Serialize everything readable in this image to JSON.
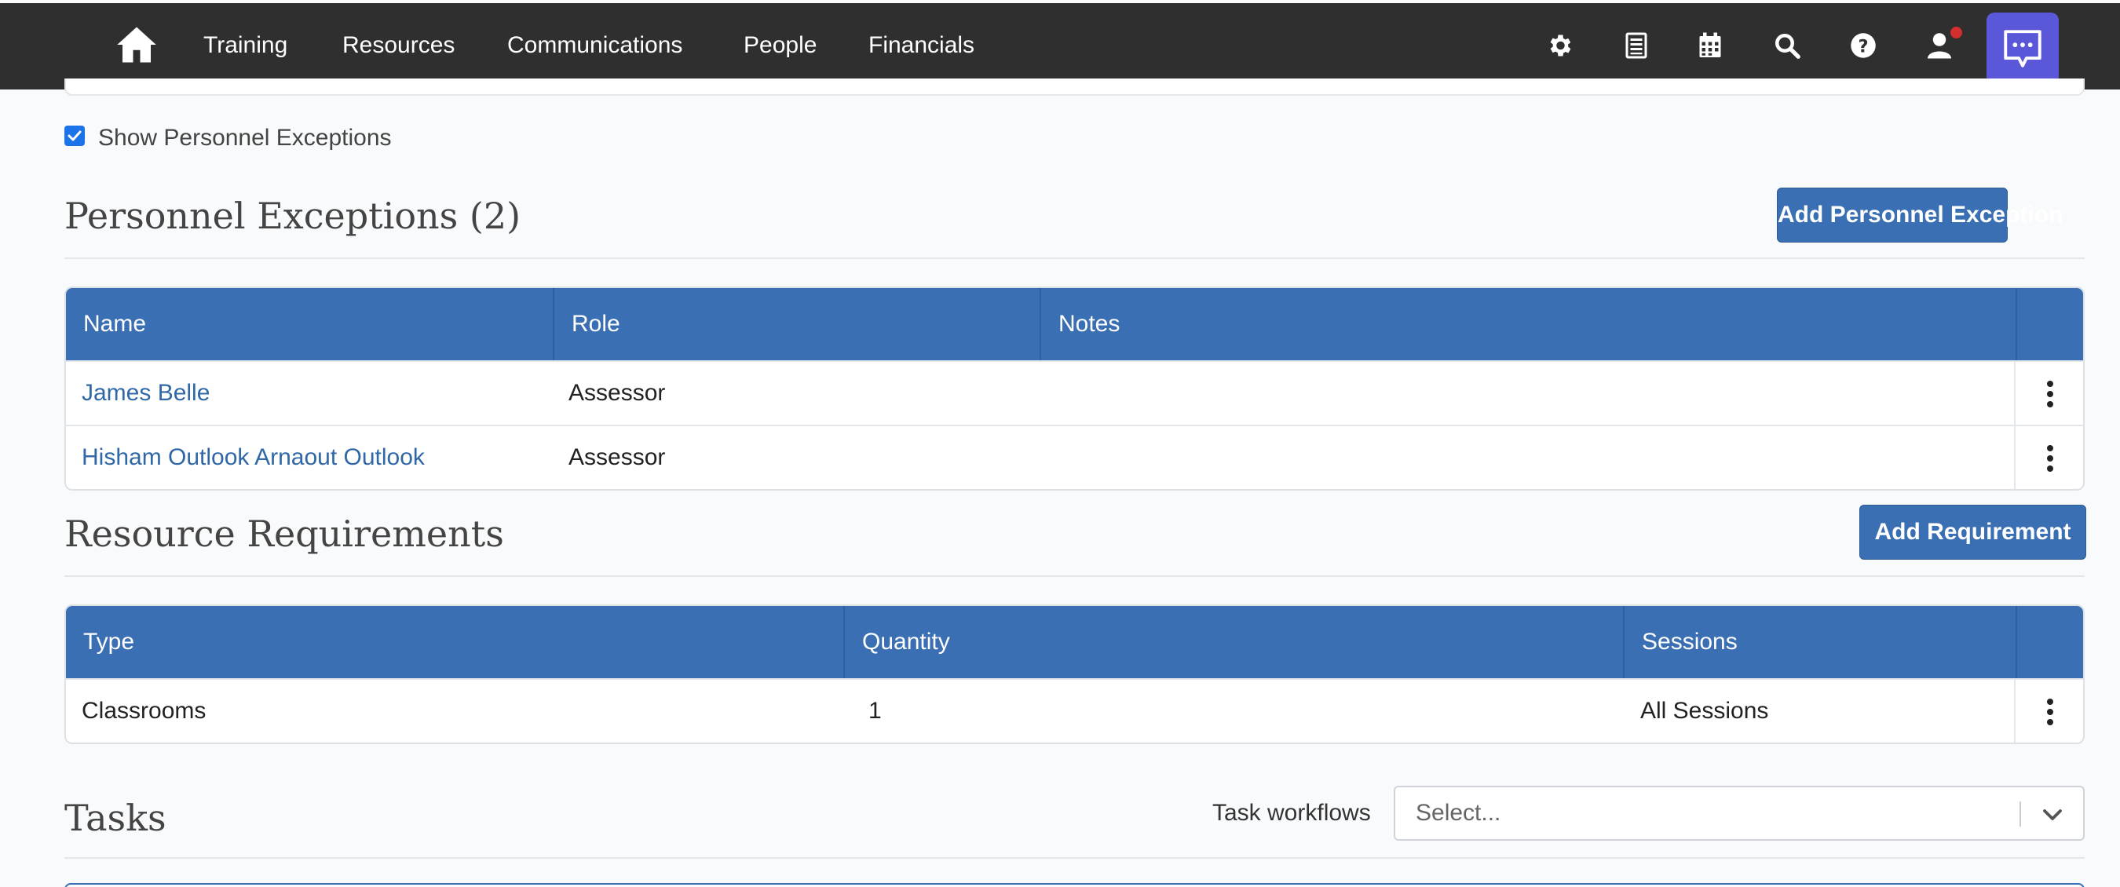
{
  "nav": {
    "links": [
      "Training",
      "Resources",
      "Communications",
      "People",
      "Financials"
    ],
    "icons": [
      "gear-icon",
      "list-icon",
      "calendar-icon",
      "search-icon",
      "help-icon",
      "user-icon"
    ],
    "chat_icon": "chat-bubble-icon"
  },
  "checkbox": {
    "label": "Show Personnel Exceptions",
    "checked": true
  },
  "personnel": {
    "title": "Personnel Exceptions (2)",
    "add_button": "Add Personnel Exception",
    "columns": [
      "Name",
      "Role",
      "Notes"
    ],
    "rows": [
      {
        "name": "James Belle",
        "role": "Assessor",
        "notes": ""
      },
      {
        "name": "Hisham Outlook Arnaout Outlook",
        "role": "Assessor",
        "notes": ""
      }
    ]
  },
  "resources": {
    "title": "Resource Requirements",
    "add_button": "Add Requirement",
    "columns": [
      "Type",
      "Quantity",
      "Sessions"
    ],
    "rows": [
      {
        "type": "Classrooms",
        "quantity": "1",
        "sessions": "All Sessions"
      }
    ]
  },
  "tasks": {
    "title": "Tasks",
    "workflows_label": "Task workflows",
    "select_placeholder": "Select..."
  },
  "colors": {
    "nav_bg": "#2f2f2f",
    "accent": "#3a6fb3",
    "chat": "#5b57d9",
    "link": "#2f67a7"
  }
}
